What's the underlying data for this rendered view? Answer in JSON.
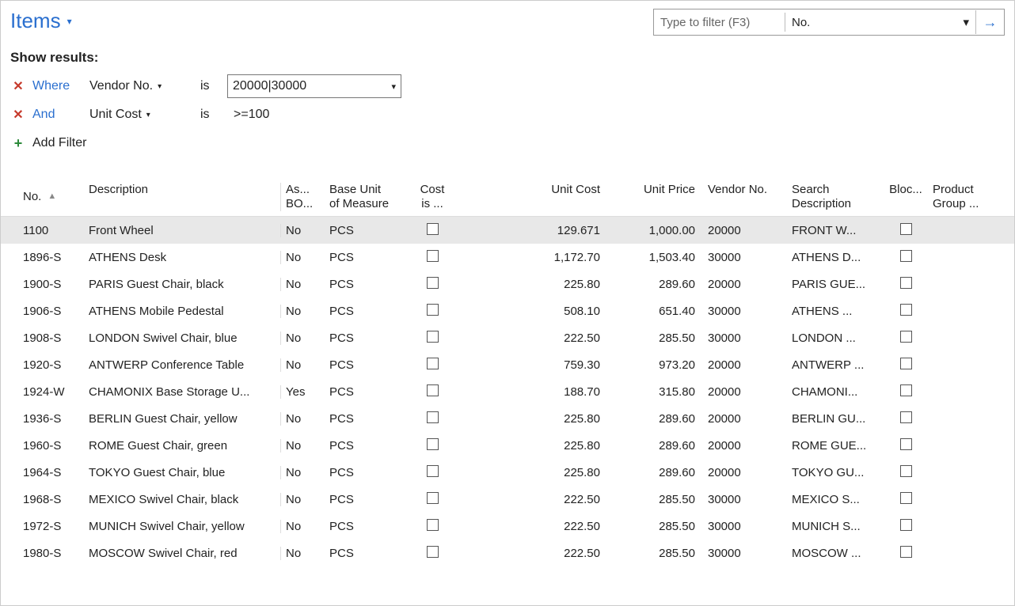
{
  "header": {
    "title": "Items",
    "search_placeholder": "Type to filter (F3)",
    "search_type_label": "No."
  },
  "filters": {
    "heading": "Show results:",
    "rows": [
      {
        "keyword": "Where",
        "field": "Vendor No.",
        "op": "is",
        "value": "20000|30000",
        "hasDropdown": true
      },
      {
        "keyword": "And",
        "field": "Unit Cost",
        "op": "is",
        "value": ">=100",
        "hasDropdown": false
      }
    ],
    "add_label": "Add Filter"
  },
  "grid": {
    "columns": {
      "no": "No.",
      "desc": "Description",
      "asbom_l1": "As...",
      "asbom_l2": "BO...",
      "uom_l1": "Base Unit",
      "uom_l2": "of Measure",
      "cost_l1": "Cost",
      "cost_l2": "is ...",
      "unitcost": "Unit Cost",
      "unitprice": "Unit Price",
      "vendor": "Vendor No.",
      "search_l1": "Search",
      "search_l2": "Description",
      "bloc": "Bloc...",
      "pgroup_l1": "Product",
      "pgroup_l2": "Group ..."
    },
    "rows": [
      {
        "no": "1100",
        "desc": "Front Wheel",
        "asbom": "No",
        "uom": "PCS",
        "unitcost": "129.671",
        "unitprice": "1,000.00",
        "vendor": "20000",
        "search": "FRONT W...",
        "selected": true
      },
      {
        "no": "1896-S",
        "desc": "ATHENS Desk",
        "asbom": "No",
        "uom": "PCS",
        "unitcost": "1,172.70",
        "unitprice": "1,503.40",
        "vendor": "30000",
        "search": "ATHENS D..."
      },
      {
        "no": "1900-S",
        "desc": "PARIS Guest Chair, black",
        "asbom": "No",
        "uom": "PCS",
        "unitcost": "225.80",
        "unitprice": "289.60",
        "vendor": "20000",
        "search": "PARIS GUE..."
      },
      {
        "no": "1906-S",
        "desc": "ATHENS Mobile Pedestal",
        "asbom": "No",
        "uom": "PCS",
        "unitcost": "508.10",
        "unitprice": "651.40",
        "vendor": "30000",
        "search": "ATHENS ..."
      },
      {
        "no": "1908-S",
        "desc": "LONDON Swivel Chair, blue",
        "asbom": "No",
        "uom": "PCS",
        "unitcost": "222.50",
        "unitprice": "285.50",
        "vendor": "30000",
        "search": "LONDON ..."
      },
      {
        "no": "1920-S",
        "desc": "ANTWERP Conference Table",
        "asbom": "No",
        "uom": "PCS",
        "unitcost": "759.30",
        "unitprice": "973.20",
        "vendor": "20000",
        "search": "ANTWERP ..."
      },
      {
        "no": "1924-W",
        "desc": "CHAMONIX Base Storage U...",
        "asbom": "Yes",
        "uom": "PCS",
        "unitcost": "188.70",
        "unitprice": "315.80",
        "vendor": "20000",
        "search": "CHAMONI..."
      },
      {
        "no": "1936-S",
        "desc": "BERLIN Guest Chair, yellow",
        "asbom": "No",
        "uom": "PCS",
        "unitcost": "225.80",
        "unitprice": "289.60",
        "vendor": "20000",
        "search": "BERLIN GU..."
      },
      {
        "no": "1960-S",
        "desc": "ROME Guest Chair, green",
        "asbom": "No",
        "uom": "PCS",
        "unitcost": "225.80",
        "unitprice": "289.60",
        "vendor": "20000",
        "search": "ROME GUE..."
      },
      {
        "no": "1964-S",
        "desc": "TOKYO Guest Chair, blue",
        "asbom": "No",
        "uom": "PCS",
        "unitcost": "225.80",
        "unitprice": "289.60",
        "vendor": "20000",
        "search": "TOKYO GU..."
      },
      {
        "no": "1968-S",
        "desc": "MEXICO Swivel Chair, black",
        "asbom": "No",
        "uom": "PCS",
        "unitcost": "222.50",
        "unitprice": "285.50",
        "vendor": "30000",
        "search": "MEXICO S..."
      },
      {
        "no": "1972-S",
        "desc": "MUNICH Swivel Chair, yellow",
        "asbom": "No",
        "uom": "PCS",
        "unitcost": "222.50",
        "unitprice": "285.50",
        "vendor": "30000",
        "search": "MUNICH S..."
      },
      {
        "no": "1980-S",
        "desc": "MOSCOW Swivel Chair, red",
        "asbom": "No",
        "uom": "PCS",
        "unitcost": "222.50",
        "unitprice": "285.50",
        "vendor": "30000",
        "search": "MOSCOW ..."
      }
    ]
  }
}
